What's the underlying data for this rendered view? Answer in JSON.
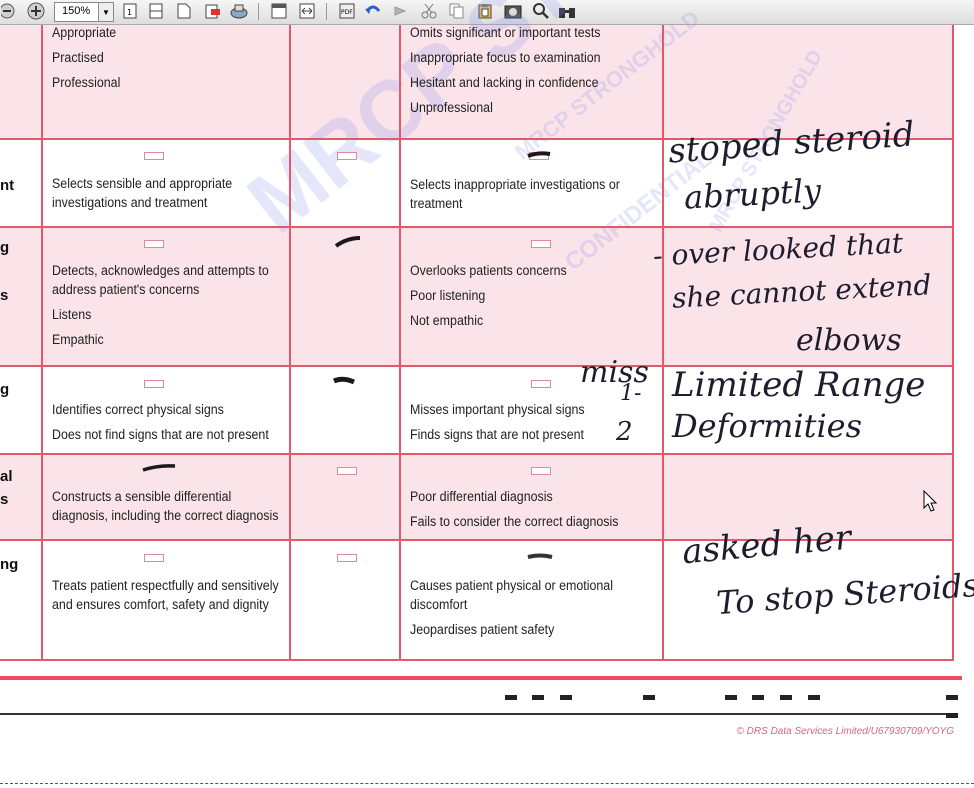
{
  "toolbar": {
    "zoom_value": "150%",
    "icons": [
      "zoom-out-icon",
      "zoom-in-icon",
      "single-page-icon",
      "continuous-page-icon",
      "fit-page-icon",
      "export-icon",
      "print-icon",
      "save-icon",
      "fit-width-icon",
      "rotate-icon",
      "back-icon",
      "forward-icon",
      "cut-icon",
      "copy-icon",
      "paste-icon",
      "snapshot-icon",
      "search-icon",
      "binoculars-icon"
    ]
  },
  "rows": [
    {
      "label": "",
      "positive": [
        "Appropriate",
        "Practised",
        "Professional"
      ],
      "negative": [
        "Omits significant or important tests",
        "Inappropriate focus to examination",
        "Hesitant and lacking in confidence",
        "Unprofessional"
      ]
    },
    {
      "label": "nt",
      "positive": [
        "Selects sensible and appropriate",
        "investigations and treatment"
      ],
      "negative": [
        "Selects inappropriate investigations or",
        "treatment"
      ]
    },
    {
      "label": "g",
      "label2": "s",
      "positive": [
        "Detects, acknowledges and attempts to",
        "address patient's concerns",
        "Listens",
        "Empathic"
      ],
      "negative": [
        "Overlooks patients concerns",
        "Poor listening",
        "Not empathic"
      ]
    },
    {
      "label": "g",
      "positive": [
        "Identifies correct physical signs",
        "Does not find signs that are not present"
      ],
      "negative": [
        "Misses important physical signs",
        "Finds signs that are not present"
      ]
    },
    {
      "label": "al",
      "label2": "s",
      "positive": [
        "Constructs a sensible differential",
        "diagnosis, including the correct diagnosis"
      ],
      "negative": [
        "Poor differential diagnosis",
        "Fails to consider the correct diagnosis"
      ]
    },
    {
      "label": "ng",
      "positive": [
        "Treats patient respectfully and sensitively",
        "and ensures comfort, safety and dignity"
      ],
      "negative": [
        "Causes patient physical or emotional",
        "discomfort",
        "Jeopardises patient safety"
      ]
    }
  ],
  "handwriting": {
    "row2_line1": "stoped steroid",
    "row2_line2": "abruptly",
    "row3_line1": "- over looked that",
    "row3_line2": "she cannot extend",
    "row3_line3": "elbows",
    "row4_miss": "miss",
    "row4_n1": "1-",
    "row4_n2": "2",
    "row4_line1": "Limited Range",
    "row4_line2": "Deformities",
    "row6_line1": "asked her",
    "row6_line2": "To stop Steroids"
  },
  "watermark": {
    "main": "MRCP STRONG",
    "small": "MRCP STRONGHOLD",
    "confidential": "CONFIDENTIAL"
  },
  "footer": {
    "copyright": "© DRS Data Services Limited/U67930709/YOYG"
  }
}
